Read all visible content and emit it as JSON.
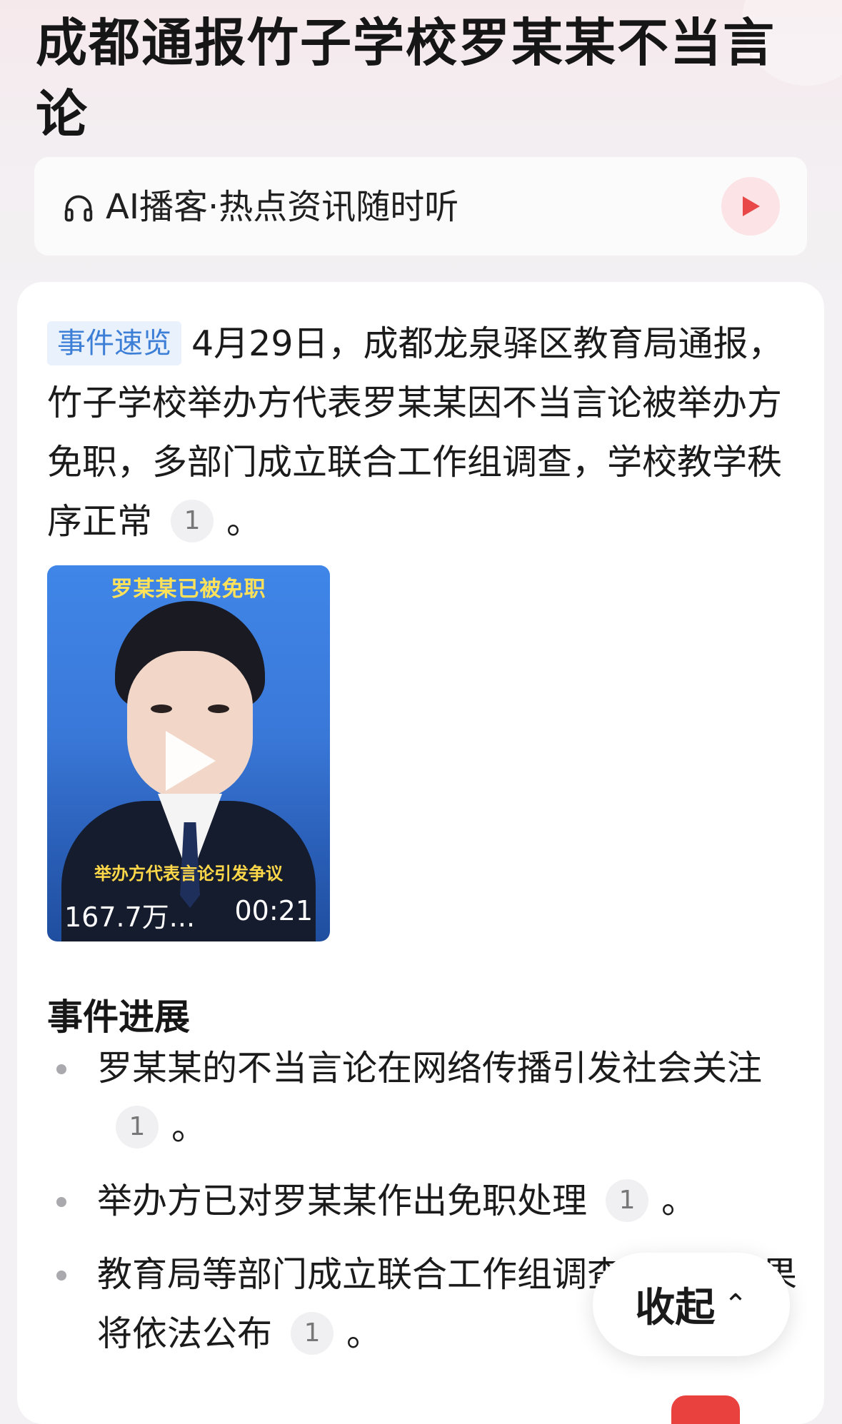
{
  "article": {
    "title": "成都通报竹子学校罗某某不当言论"
  },
  "ai_podcast": {
    "label": "AI播客·热点资讯随时听",
    "icon": "headphone-icon",
    "play_icon": "play-icon",
    "play_color": "#e84848"
  },
  "summary": {
    "tag": "事件速览",
    "text": "4月29日，成都龙泉驿区教育局通报，竹子学校举办方代表罗某某因不当言论被举办方免职，多部门成立联合工作组调查，学校教学秩序正常",
    "cite": "1",
    "end": "。"
  },
  "video": {
    "caption_top": "罗某某已被免职",
    "caption_bottom": "举办方代表言论引发争议",
    "views": "167.7万...",
    "duration": "00:21"
  },
  "progress": {
    "heading": "事件进展",
    "items": [
      {
        "text": "罗某某的不当言论在网络传播引发社会关注",
        "cite": "1",
        "end": "。"
      },
      {
        "text": "举办方已对罗某某作出免职处理",
        "cite": "1",
        "end": "。"
      },
      {
        "text": "教育局等部门成立联合工作组调查，后续结果将依法公布",
        "cite": "1",
        "end": "。"
      }
    ]
  },
  "collapse": {
    "label": "收起",
    "icon": "chevron-up-icon"
  },
  "colors": {
    "tag_bg": "#e8f1fc",
    "tag_text": "#3d7fd6",
    "accent_red": "#e8413e"
  }
}
